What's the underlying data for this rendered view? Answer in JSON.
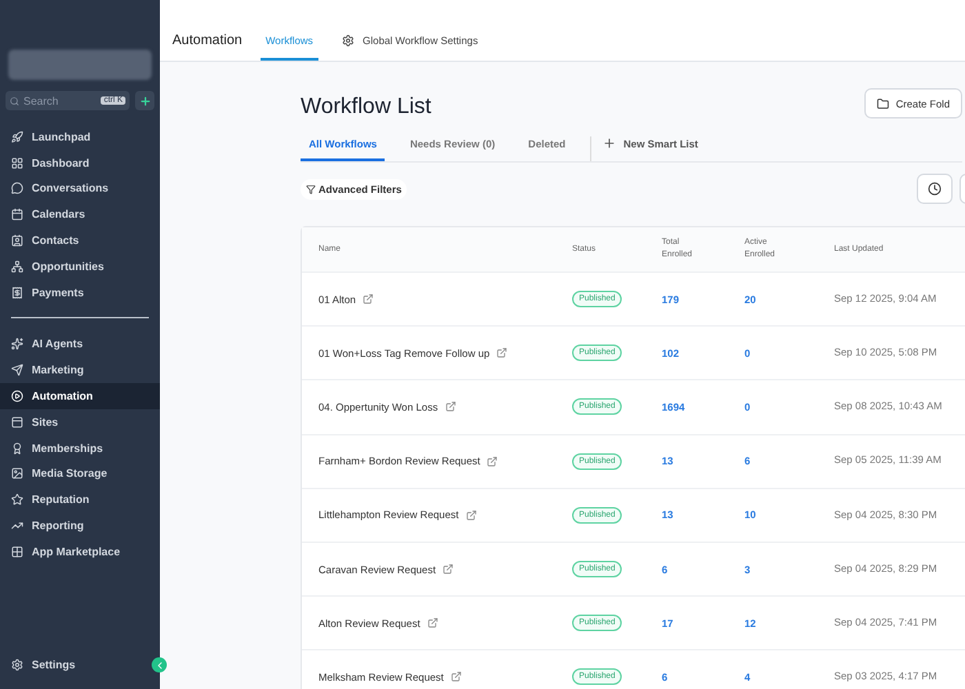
{
  "sidebar": {
    "search": {
      "placeholder": "Search",
      "shortcut": "ctrl K"
    },
    "nav_groups": [
      [
        {
          "label": "Launchpad",
          "selected": false
        },
        {
          "label": "Dashboard",
          "selected": false
        },
        {
          "label": "Conversations",
          "selected": false
        },
        {
          "label": "Calendars",
          "selected": false
        },
        {
          "label": "Contacts",
          "selected": false
        },
        {
          "label": "Opportunities",
          "selected": false
        },
        {
          "label": "Payments",
          "selected": false
        }
      ],
      [
        {
          "label": "AI Agents",
          "selected": false
        },
        {
          "label": "Marketing",
          "selected": false
        },
        {
          "label": "Automation",
          "selected": true
        },
        {
          "label": "Sites",
          "selected": false
        },
        {
          "label": "Memberships",
          "selected": false
        },
        {
          "label": "Media Storage",
          "selected": false
        },
        {
          "label": "Reputation",
          "selected": false
        },
        {
          "label": "Reporting",
          "selected": false
        },
        {
          "label": "App Marketplace",
          "selected": false
        }
      ]
    ],
    "settings": "Settings"
  },
  "header": {
    "section": "Automation",
    "tabs": [
      {
        "label": "Workflows",
        "selected": true
      },
      {
        "label": "Global Workflow Settings",
        "selected": false
      }
    ]
  },
  "page": {
    "title": "Workflow List",
    "create_folder": "Create Fold",
    "tabs": [
      {
        "label": "All Workflows",
        "selected": true
      },
      {
        "label": "Needs Review (0)",
        "selected": false
      },
      {
        "label": "Deleted",
        "selected": false
      }
    ],
    "new_smart_list": "New Smart List",
    "advanced_filters": "Advanced Filters"
  },
  "table": {
    "columns": [
      "Name",
      "Status",
      "Total Enrolled",
      "Active Enrolled",
      "Last Updated"
    ],
    "rows": [
      {
        "name": "01 Alton",
        "status": "Published",
        "total": "179",
        "active": "20",
        "updated": "Sep 12 2025, 9:04 AM"
      },
      {
        "name": "01 Won+Loss Tag Remove Follow up",
        "status": "Published",
        "total": "102",
        "active": "0",
        "updated": "Sep 10 2025, 5:08 PM"
      },
      {
        "name": "04. Oppertunity Won Loss",
        "status": "Published",
        "total": "1694",
        "active": "0",
        "updated": "Sep 08 2025, 10:43 AM"
      },
      {
        "name": "Farnham+ Bordon Review Request",
        "status": "Published",
        "total": "13",
        "active": "6",
        "updated": "Sep 05 2025, 11:39 AM"
      },
      {
        "name": "Littlehampton Review Request",
        "status": "Published",
        "total": "13",
        "active": "10",
        "updated": "Sep 04 2025, 8:30 PM"
      },
      {
        "name": "Caravan Review Request",
        "status": "Published",
        "total": "6",
        "active": "3",
        "updated": "Sep 04 2025, 8:29 PM"
      },
      {
        "name": "Alton Review Request",
        "status": "Published",
        "total": "17",
        "active": "12",
        "updated": "Sep 04 2025, 7:41 PM"
      },
      {
        "name": "Melksham Review Request",
        "status": "Published",
        "total": "6",
        "active": "4",
        "updated": "Sep 03 2025, 4:17 PM"
      }
    ]
  }
}
